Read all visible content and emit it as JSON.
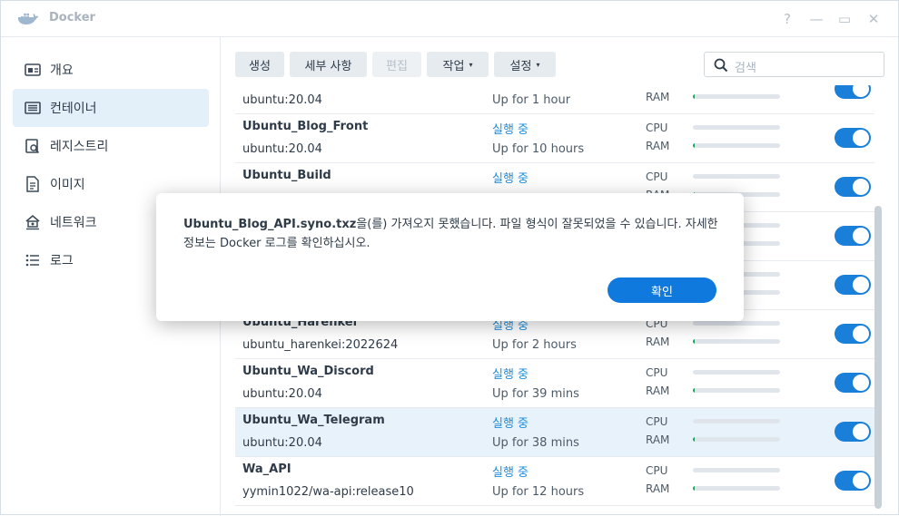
{
  "window": {
    "title": "Docker"
  },
  "controls": {
    "help": "?",
    "minimize": "—",
    "maximize": "▭",
    "close": "✕"
  },
  "sidebar": {
    "items": [
      {
        "label": "개요",
        "active": false
      },
      {
        "label": "컨테이너",
        "active": true
      },
      {
        "label": "레지스트리",
        "active": false
      },
      {
        "label": "이미지",
        "active": false
      },
      {
        "label": "네트워크",
        "active": false
      },
      {
        "label": "로그",
        "active": false
      }
    ]
  },
  "toolbar": {
    "create": "생성",
    "details": "세부 사항",
    "edit": "편집",
    "action": "작업",
    "settings": "설정",
    "caret": "▾"
  },
  "search": {
    "placeholder": "검색"
  },
  "labels": {
    "cpu": "CPU",
    "ram": "RAM"
  },
  "containers": [
    {
      "name": "",
      "image": "ubuntu:20.04",
      "status": "",
      "uptime": "Up for 1 hour",
      "cpu_pct": 0,
      "ram_pct": 1,
      "enabled": true
    },
    {
      "name": "Ubuntu_Blog_Front",
      "image": "ubuntu:20.04",
      "status": "실행 중",
      "uptime": "Up for 10 hours",
      "cpu_pct": 0,
      "ram_pct": 1,
      "enabled": true
    },
    {
      "name": "Ubuntu_Build",
      "image": "",
      "status": "실행 중",
      "uptime": "",
      "cpu_pct": 0,
      "ram_pct": 1,
      "enabled": true
    },
    {
      "name": "",
      "image": "",
      "status": "",
      "uptime": "",
      "cpu_pct": 0,
      "ram_pct": 1,
      "enabled": true
    },
    {
      "name": "",
      "image": "",
      "status": "",
      "uptime": "",
      "cpu_pct": 0,
      "ram_pct": 1,
      "enabled": true
    },
    {
      "name": "Ubuntu_Harenkei",
      "image": "ubuntu_harenkei:2022624",
      "status": "실행 중",
      "uptime": "Up for 2 hours",
      "cpu_pct": 0,
      "ram_pct": 1,
      "enabled": true
    },
    {
      "name": "Ubuntu_Wa_Discord",
      "image": "ubuntu:20.04",
      "status": "실행 중",
      "uptime": "Up for 39 mins",
      "cpu_pct": 0,
      "ram_pct": 1,
      "enabled": true
    },
    {
      "name": "Ubuntu_Wa_Telegram",
      "image": "ubuntu:20.04",
      "status": "실행 중",
      "uptime": "Up for 38 mins",
      "cpu_pct": 0,
      "ram_pct": 1,
      "enabled": true,
      "selected": true
    },
    {
      "name": "Wa_API",
      "image": "yymin1022/wa-api:release10",
      "status": "실행 중",
      "uptime": "Up for 12 hours",
      "cpu_pct": 0,
      "ram_pct": 1,
      "enabled": true
    }
  ],
  "dialog": {
    "file": "Ubuntu_Blog_API.syno.txz",
    "message": "을(를) 가져오지 못했습니다. 파일 형식이 잘못되었을 수 있습니다. 자세한 정보는 Docker 로그를 확인하십시오.",
    "ok": "확인"
  },
  "colors": {
    "accent": "#1079dd",
    "running": "#1a8ee0",
    "selected_row": "#e8f2fb"
  }
}
